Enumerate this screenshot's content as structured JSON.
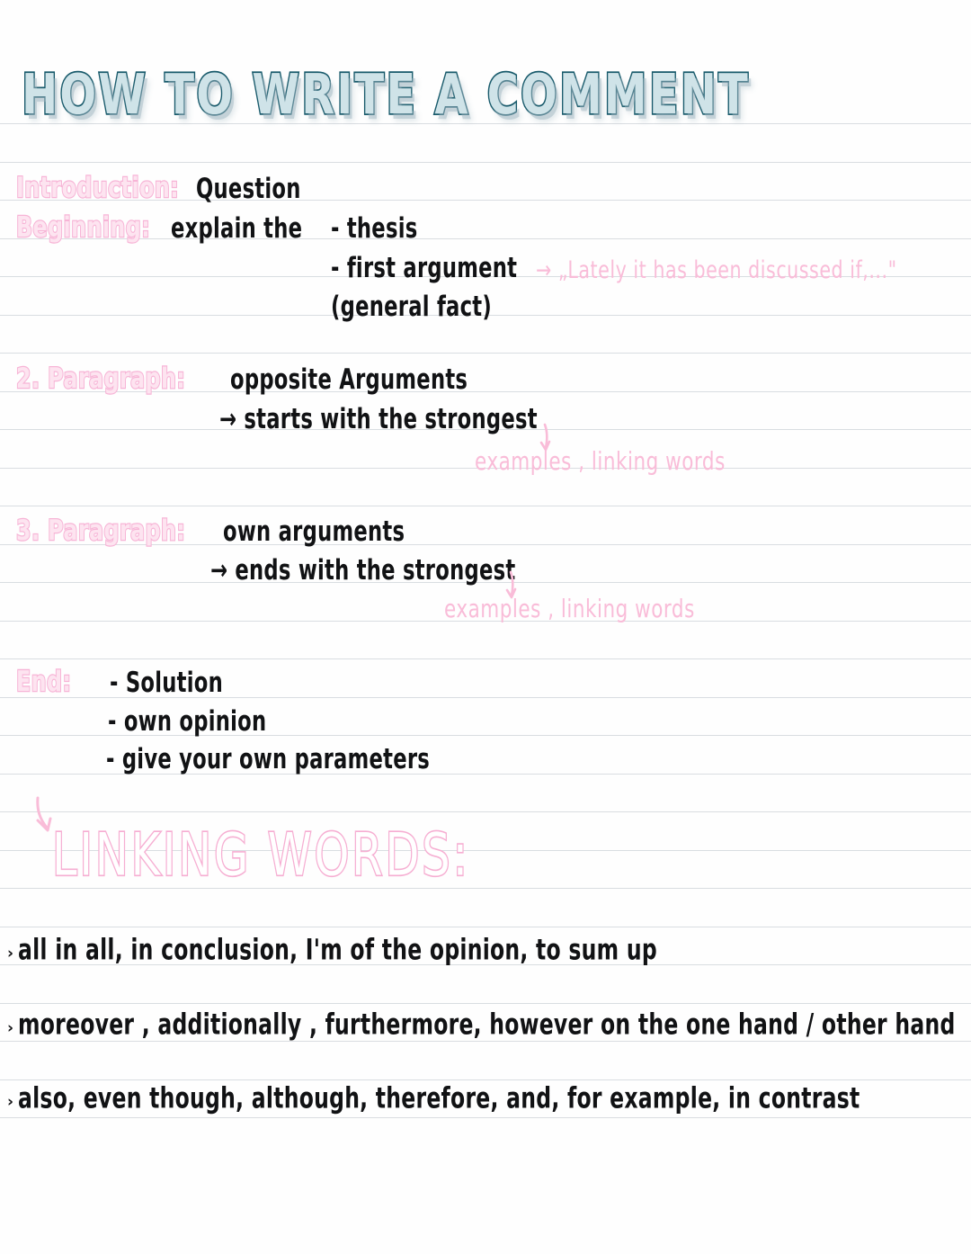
{
  "document": {
    "title": "HOW TO WRITE A COMMENT",
    "paper_line_color": "#d9dde1",
    "title_ink_color": "#185a6b",
    "pink_ink_color": "#f7b4d6",
    "black_ink_color": "#111214"
  },
  "outline": {
    "intro": {
      "label": "Introduction:",
      "value": "Question"
    },
    "beginning": {
      "label": "Beginning:",
      "value": "explain the",
      "items": [
        "- thesis",
        "- first argument",
        "(general fact)"
      ],
      "example_note": "→ „Lately it has been discussed if,...\""
    },
    "paragraph2": {
      "label": "2. Paragraph:",
      "value": "opposite Arguments",
      "detail": "→ starts with the strongest",
      "note": "examples , linking words"
    },
    "paragraph3": {
      "label": "3. Paragraph:",
      "value": "own arguments",
      "detail": "→ ends with the strongest",
      "note": "examples , linking words"
    },
    "end": {
      "label": "End:",
      "items": [
        "- Solution",
        "- own opinion",
        "- give your own parameters"
      ]
    }
  },
  "linking_words": {
    "heading": "LINKING WORDS:",
    "bullet_marker": "›",
    "rows": [
      "all in all, in conclusion, I'm of the opinion, to sum up",
      "moreover , additionally , furthermore, however on the one hand / other hand",
      "also, even though, although, therefore, and, for example, in contrast"
    ]
  }
}
